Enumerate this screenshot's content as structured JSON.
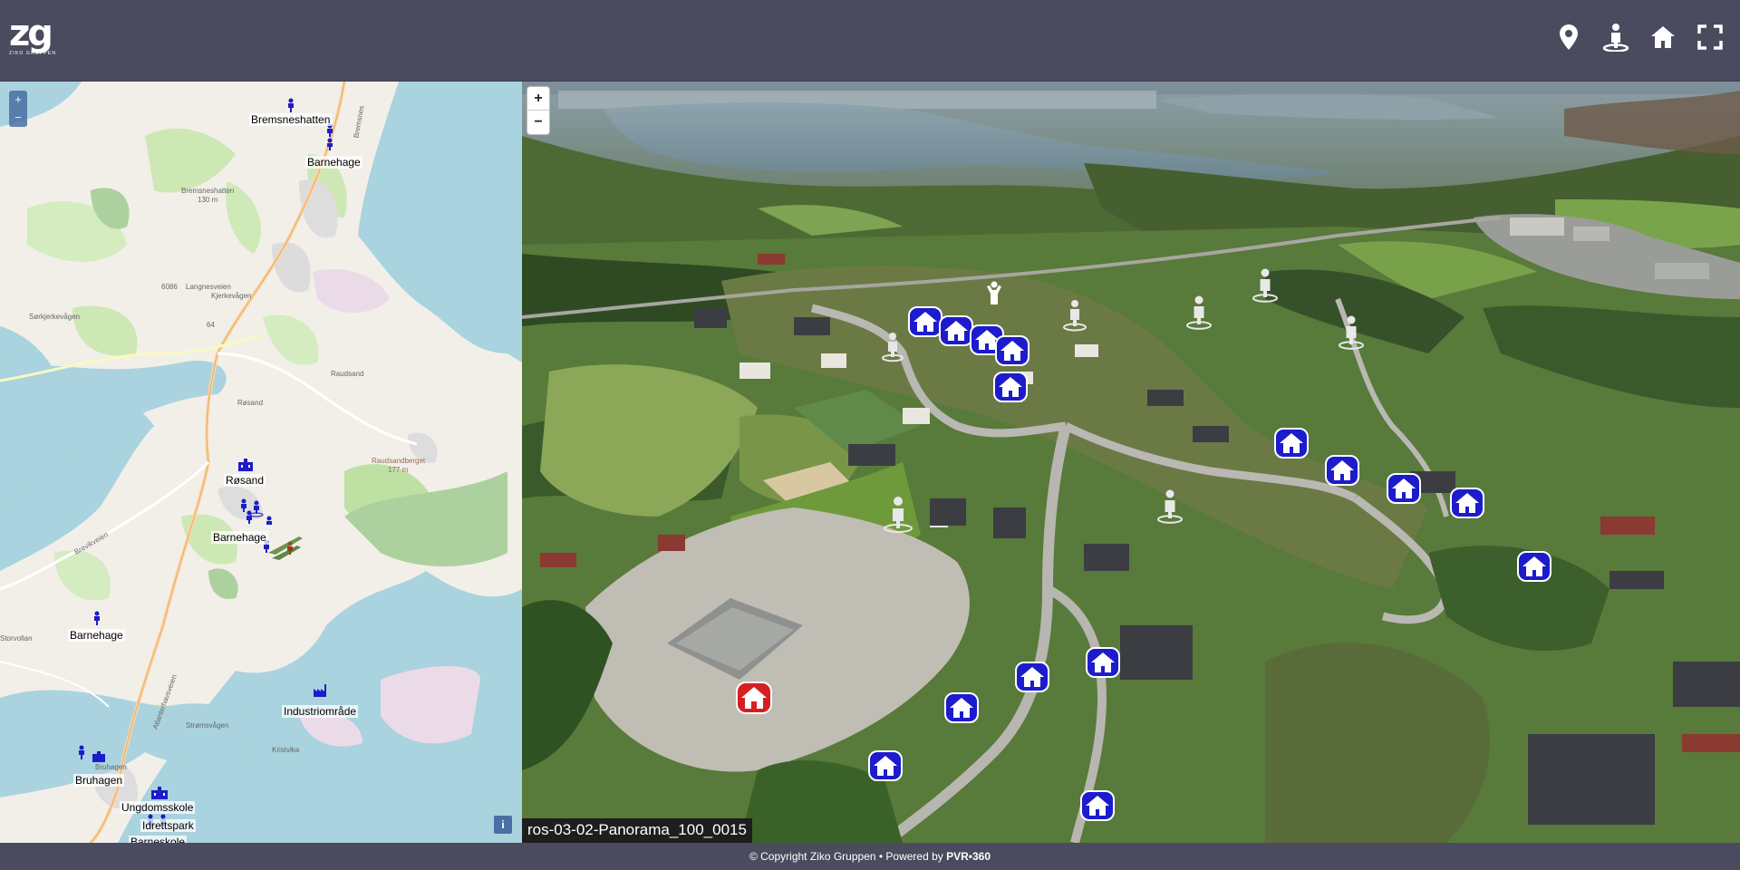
{
  "header": {
    "logo_mark": "zg",
    "logo_sub": "ZIKO GRUPPEN",
    "icons": [
      "map-pin-icon",
      "person-hotspot-icon",
      "home-icon",
      "fullscreen-icon"
    ]
  },
  "map": {
    "zoom_in": "+",
    "zoom_out": "−",
    "info": "i",
    "places": {
      "bremsneshatten": "Bremsneshatten",
      "barnehage_top": "Barnehage",
      "rosand": "Røsand",
      "barnehage_mid": "Barnehage",
      "barnehage_left": "Barnehage",
      "industri": "Industriområde",
      "bruhagen": "Bruhagen",
      "ungdomsskole": "Ungdomsskole",
      "idrettspark": "Idrettspark",
      "barneskole": "Barneskole"
    },
    "faint": {
      "bremsnes": "Bremsnes",
      "bremsneshatten_hill": "Bremsneshatten",
      "hill_height": "130 m",
      "road_6086": "6086",
      "langnesveien": "Langnesveien",
      "kjerkevagen": "Kjerkevågen",
      "sorkjerkevagen": "Sørkjerkevågen",
      "road_64": "64",
      "raudsand": "Raudsand",
      "rosand_small": "Røsand",
      "raudsandberget": "Raudsandberget",
      "raudsandberget_height": "177 m",
      "storvollan": "Storvollan",
      "kristvika": "Kristvika",
      "strommen": "Strømsvågen",
      "bruhagen_small": "Bruhagen",
      "atlanterhavsveien": "Atlanterhavsveien",
      "brevikveien": "Brevikveien"
    }
  },
  "pano": {
    "zoom_in": "+",
    "zoom_out": "−",
    "title": "ros-03-02-Panorama_100_0015"
  },
  "footer": {
    "copyright": "© Copyright Ziko Gruppen • Powered by ",
    "powered": "PVR•360"
  },
  "colors": {
    "header_bg": "#4b4b5f",
    "hotspot_blue": "#1c1ccc",
    "hotspot_red": "#d42020"
  }
}
